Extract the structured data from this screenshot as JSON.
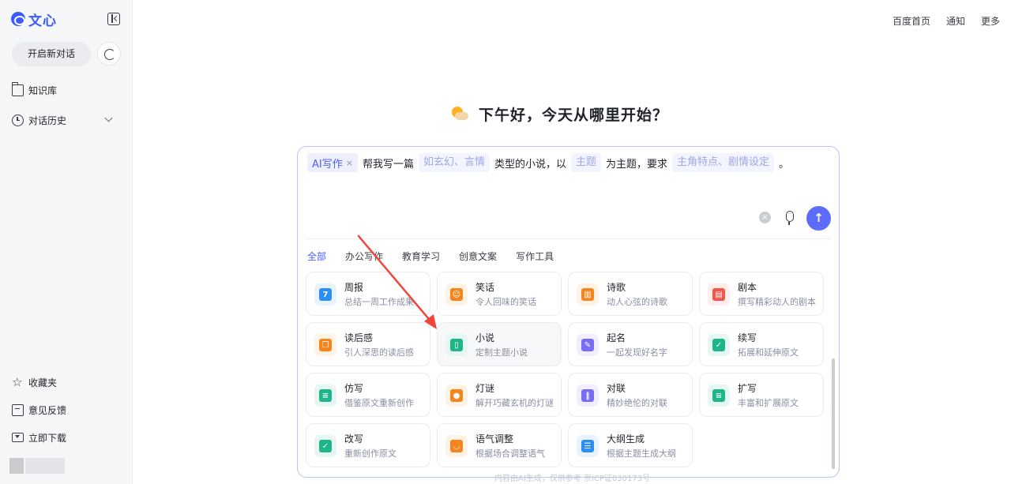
{
  "sidebar": {
    "logo_text": "文心",
    "new_chat_label": "开启新对话",
    "items": [
      {
        "label": "知识库",
        "icon": "folder-icon"
      },
      {
        "label": "对话历史",
        "icon": "clock-icon"
      }
    ],
    "bottom_items": [
      {
        "label": "收藏夹",
        "icon": "star-icon"
      },
      {
        "label": "意见反馈",
        "icon": "feedback-icon"
      },
      {
        "label": "立即下载",
        "icon": "download-icon"
      }
    ]
  },
  "topnav": [
    "百度首页",
    "通知",
    "更多"
  ],
  "greeting": "下午好，今天从哪里开始？",
  "prompt": {
    "tag": "AI写作",
    "tag_close": "×",
    "segments": [
      {
        "type": "text",
        "value": "帮我写一篇"
      },
      {
        "type": "slot",
        "value": "如玄幻、言情"
      },
      {
        "type": "text",
        "value": "类型的小说，以"
      },
      {
        "type": "slot",
        "value": "主题"
      },
      {
        "type": "text",
        "value": "为主题，要求"
      },
      {
        "type": "slot",
        "value": "主角特点、剧情设定"
      },
      {
        "type": "text",
        "value": "。"
      }
    ],
    "clear_glyph": "×",
    "send_glyph": "↑"
  },
  "tabs": [
    "全部",
    "办公写作",
    "教育学习",
    "创意文案",
    "写作工具"
  ],
  "active_tab": 0,
  "templates": [
    {
      "title": "周报",
      "desc": "总结一周工作成果",
      "icon": "calendar-icon",
      "bg": "#e8f3ff",
      "fg": "#2b8ef2",
      "glyph": "7"
    },
    {
      "title": "笑话",
      "desc": "令人回味的笑话",
      "icon": "laugh-icon",
      "bg": "#fff3e6",
      "fg": "#f5861f",
      "glyph": "☺"
    },
    {
      "title": "诗歌",
      "desc": "动人心弦的诗歌",
      "icon": "poem-icon",
      "bg": "#fff3e6",
      "fg": "#f5861f",
      "glyph": "▥"
    },
    {
      "title": "剧本",
      "desc": "撰写精彩动人的剧本",
      "icon": "clapper-icon",
      "bg": "#ffeceb",
      "fg": "#f0564a",
      "glyph": "▤"
    },
    {
      "title": "读后感",
      "desc": "引人深思的读后感",
      "icon": "notes-icon",
      "bg": "#fff3e6",
      "fg": "#f5861f",
      "glyph": "❐"
    },
    {
      "title": "小说",
      "desc": "定制主题小说",
      "icon": "book-icon",
      "bg": "#e6f7f2",
      "fg": "#1fb58a",
      "glyph": "▯"
    },
    {
      "title": "起名",
      "desc": "一起发现好名字",
      "icon": "name-card-icon",
      "bg": "#f0eeff",
      "fg": "#7b6cf6",
      "glyph": "✎"
    },
    {
      "title": "续写",
      "desc": "拓展和延伸原文",
      "icon": "continue-pen-icon",
      "bg": "#e6f7f2",
      "fg": "#1fb58a",
      "glyph": "✓"
    },
    {
      "title": "仿写",
      "desc": "借鉴原文重新创作",
      "icon": "imitate-icon",
      "bg": "#e6f7f2",
      "fg": "#1fb58a",
      "glyph": "≡"
    },
    {
      "title": "灯谜",
      "desc": "解开巧藏玄机的灯谜",
      "icon": "lantern-icon",
      "bg": "#fff3e6",
      "fg": "#f5861f",
      "glyph": "●"
    },
    {
      "title": "对联",
      "desc": "精妙绝伦的对联",
      "icon": "couplet-icon",
      "bg": "#f0eeff",
      "fg": "#7b6cf6",
      "glyph": "‖"
    },
    {
      "title": "扩写",
      "desc": "丰富和扩展原文",
      "icon": "expand-icon",
      "bg": "#e6f7f2",
      "fg": "#1fb58a",
      "glyph": "≡"
    },
    {
      "title": "改写",
      "desc": "重新创作原文",
      "icon": "rewrite-icon",
      "bg": "#e6f7f2",
      "fg": "#1fb58a",
      "glyph": "✓"
    },
    {
      "title": "语气调整",
      "desc": "根据场合调整语气",
      "icon": "tone-icon",
      "bg": "#fff3e6",
      "fg": "#f5861f",
      "glyph": "◡"
    },
    {
      "title": "大纲生成",
      "desc": "根据主题生成大纲",
      "icon": "outline-icon",
      "bg": "#e8f3ff",
      "fg": "#2b8ef2",
      "glyph": "☰"
    }
  ],
  "footer_note": "内容由AI生成，仅供参考 京ICP证030173号",
  "colors": {
    "accent": "#4b5cff",
    "send": "#5c6cff",
    "annotation_arrow": "#f0453a"
  }
}
